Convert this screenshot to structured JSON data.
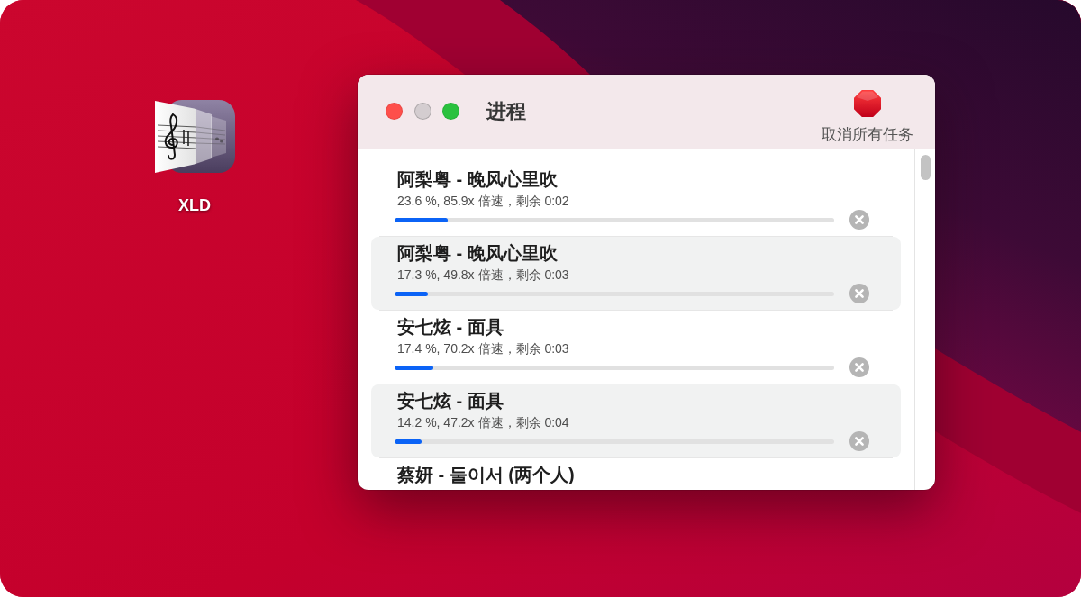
{
  "desktop": {
    "icons": [
      {
        "label": "XLD"
      }
    ]
  },
  "window": {
    "controls": [
      {
        "kind": "close",
        "disabled": false
      },
      {
        "kind": "minimize",
        "disabled": true
      },
      {
        "kind": "zoom",
        "disabled": false
      }
    ],
    "title": "进程",
    "toolbar": [
      {
        "kind": "stop",
        "label": "取消所有任务"
      }
    ]
  },
  "tasks": [
    {
      "title": "阿梨粤 - 晚风心里吹",
      "status": "23.6 %, 85.9x 倍速，剩余 0:02",
      "level": 0.12
    },
    {
      "title": "阿梨粤 - 晚风心里吹",
      "status": "17.3 %, 49.8x 倍速，剩余 0:03",
      "level": 0.076
    },
    {
      "title": "安七炫 - 面具",
      "status": "17.4 %, 70.2x 倍速，剩余 0:03",
      "level": 0.088
    },
    {
      "title": "安七炫 - 面具",
      "status": "14.2 %, 47.2x 倍速，剩余 0:04",
      "level": 0.061
    },
    {
      "title": "蔡妍 - 둘이서 (两个人)"
    }
  ]
}
